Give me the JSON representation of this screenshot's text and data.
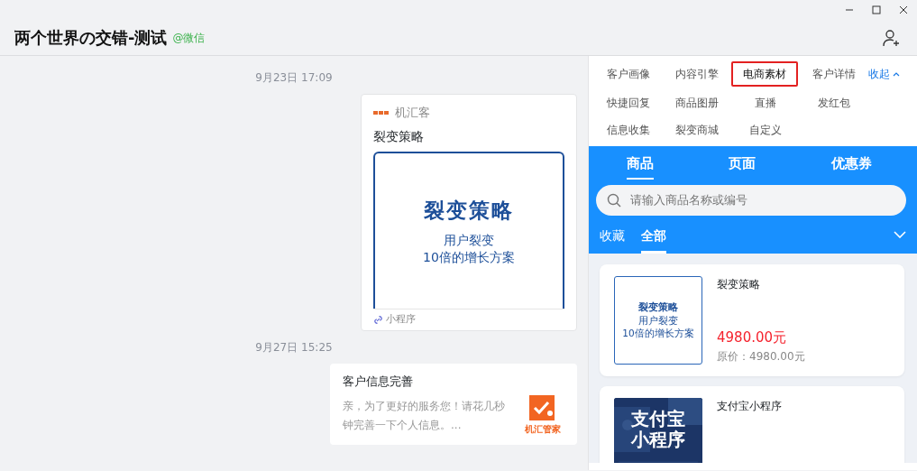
{
  "header": {
    "title": "两个世界の交错-测试",
    "source": "@微信"
  },
  "chat": [
    {
      "kind": "time",
      "text": "9月23日 17:09"
    },
    {
      "kind": "mini_program",
      "app": "机汇客",
      "title": "裂变策略",
      "banner_title": "裂变策略",
      "banner_lines": [
        "用户裂变",
        "10倍的增长方案"
      ],
      "footer": "小程序"
    },
    {
      "kind": "time",
      "text": "9月27日 15:25"
    },
    {
      "kind": "link_card",
      "title": "客户信息完善",
      "desc": "亲，为了更好的服务您！请花几秒钟完善一下个人信息。...",
      "logo_text": "机汇管家"
    }
  ],
  "tools": {
    "items": [
      {
        "label": "客户画像",
        "selected": false
      },
      {
        "label": "内容引擎",
        "selected": false
      },
      {
        "label": "电商素材",
        "selected": true
      },
      {
        "label": "客户详情",
        "selected": false
      },
      {
        "label": "快捷回复",
        "selected": false
      },
      {
        "label": "商品图册",
        "selected": false
      },
      {
        "label": "直播",
        "selected": false
      },
      {
        "label": "发红包",
        "selected": false
      },
      {
        "label": "信息收集",
        "selected": false
      },
      {
        "label": "裂变商城",
        "selected": false
      },
      {
        "label": "自定义",
        "selected": false
      }
    ],
    "collapse": "收起"
  },
  "shop": {
    "tabs": [
      {
        "label": "商品",
        "selected": true
      },
      {
        "label": "页面",
        "selected": false
      },
      {
        "label": "优惠券",
        "selected": false
      }
    ],
    "search": {
      "placeholder": "请输入商品名称或编号"
    },
    "filters": [
      {
        "label": "收藏",
        "selected": false
      },
      {
        "label": "全部",
        "selected": true
      }
    ],
    "products": [
      {
        "name": "裂变策略",
        "kind": "text_thumb",
        "thumb_title": "裂变策略",
        "thumb_lines": [
          "用户裂变",
          "10倍的增长方案"
        ],
        "price": "4980.00元",
        "original": "原价：4980.00元"
      },
      {
        "name": "支付宝小程序",
        "kind": "picture",
        "thumb_title": "支付宝小程序"
      }
    ]
  }
}
